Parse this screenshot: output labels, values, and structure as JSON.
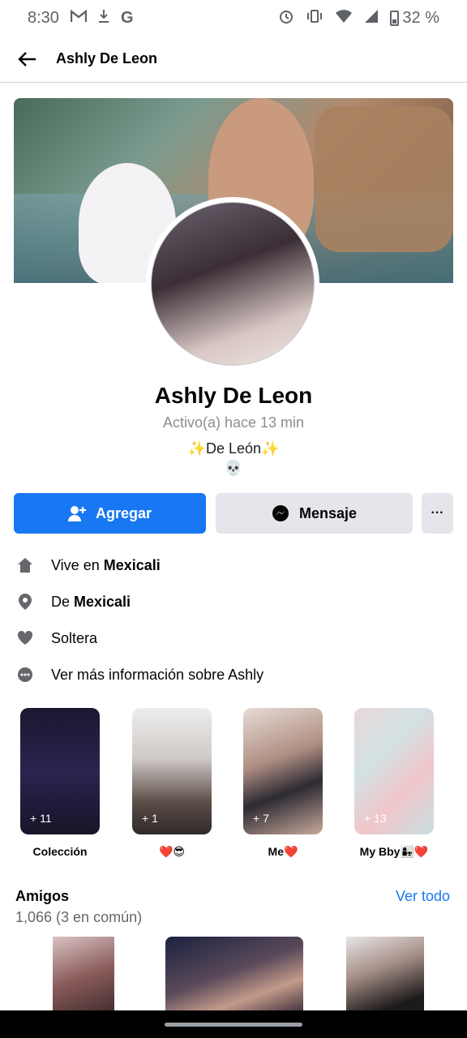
{
  "status_bar": {
    "time": "8:30",
    "battery": "32 %",
    "icons_left": [
      "gmail-icon",
      "download-icon",
      "google-icon"
    ],
    "icons_right": [
      "alarm-icon",
      "vibrate-icon",
      "wifi-icon",
      "signal-icon",
      "battery-icon"
    ]
  },
  "nav": {
    "title": "Ashly De Leon"
  },
  "profile": {
    "name": "Ashly De Leon",
    "active_status": "Activo(a) hace 13 min",
    "bio_line1": "✨De León✨",
    "bio_line2": "💀"
  },
  "actions": {
    "add_label": "Agregar",
    "message_label": "Mensaje",
    "more_label": "···"
  },
  "info": {
    "lives_in_prefix": "Vive en",
    "lives_in_value": "Mexicali",
    "from_prefix": "De",
    "from_value": "Mexicali",
    "relationship": "Soltera",
    "more_info": "Ver más información sobre Ashly"
  },
  "featured": [
    {
      "label": "Colección",
      "count": "+ 11"
    },
    {
      "label": "❤️😎",
      "count": "+ 1"
    },
    {
      "label": "Me❤️",
      "count": "+ 7"
    },
    {
      "label": "My Bby👩‍👧❤️",
      "count": "+ 13"
    }
  ],
  "friends": {
    "title": "Amigos",
    "see_all": "Ver todo",
    "count": "1,066 (3 en común)"
  },
  "colors": {
    "accent": "#1877f2",
    "secondary_button": "#e4e6eb",
    "muted_text": "#65676b"
  }
}
